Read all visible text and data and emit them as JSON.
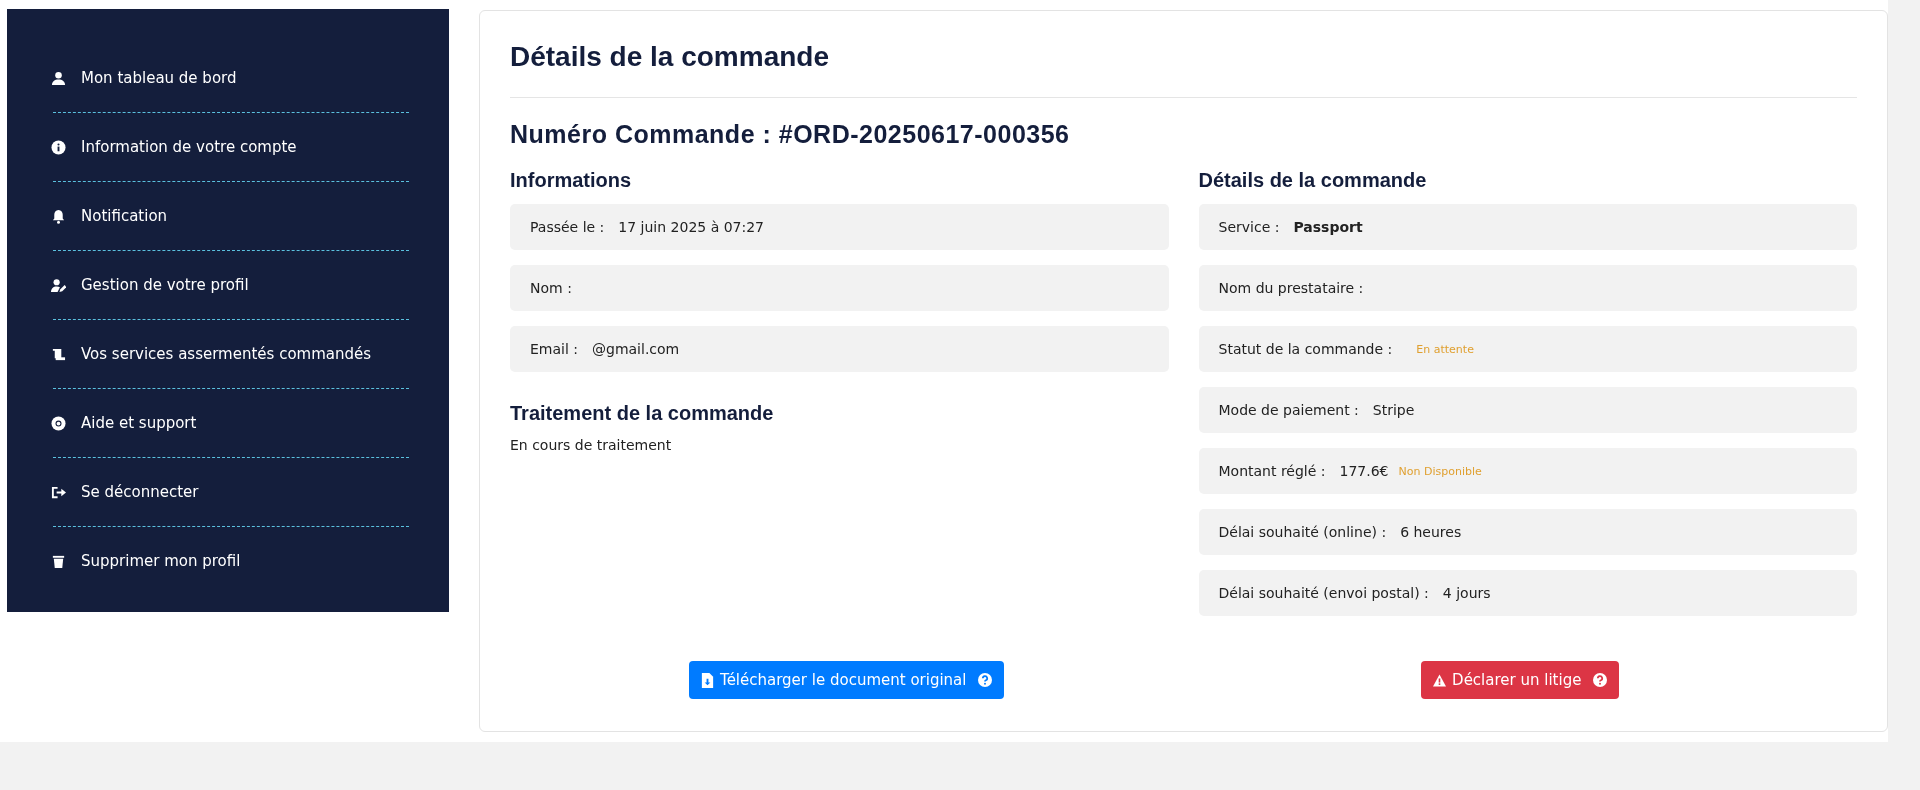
{
  "sidebar": {
    "items": [
      {
        "label": "Mon tableau de bord"
      },
      {
        "label": "Information de votre compte"
      },
      {
        "label": "Notification"
      },
      {
        "label": "Gestion de votre profil"
      },
      {
        "label": "Vos services assermentés commandés"
      },
      {
        "label": "Aide et support"
      },
      {
        "label": "Se déconnecter"
      },
      {
        "label": "Supprimer mon profil"
      }
    ]
  },
  "main": {
    "title": "Détails de la commande",
    "order_number": "Numéro Commande : #ORD-20250617-000356",
    "informations": {
      "heading": "Informations",
      "rows": [
        {
          "label": "Passée le :",
          "value": "17 juin 2025 à 07:27"
        },
        {
          "label": "Nom :"
        },
        {
          "label": "Email :",
          "value": "@gmail.com"
        }
      ]
    },
    "processing": {
      "heading": "Traitement de la commande",
      "text": "En cours de traitement"
    },
    "details": {
      "heading": "Détails de la commande",
      "rows": [
        {
          "label": "Service :",
          "value": "Passport",
          "strong": true
        },
        {
          "label": "Nom du prestataire :"
        },
        {
          "label": "Statut de la commande :",
          "badge": "En attente"
        },
        {
          "label": "Mode de paiement :",
          "value": "Stripe"
        },
        {
          "label": "Montant réglé :",
          "value": "177.6€",
          "badge": "Non Disponible"
        },
        {
          "label": "Délai souhaité (online) :",
          "value": "6 heures"
        },
        {
          "label": "Délai souhaité (envoi postal) :",
          "value": "4 jours"
        }
      ]
    },
    "buttons": [
      {
        "label": "Télécharger le document original",
        "kind": "primary"
      },
      {
        "label": "Déclarer un litige",
        "kind": "danger"
      }
    ]
  }
}
